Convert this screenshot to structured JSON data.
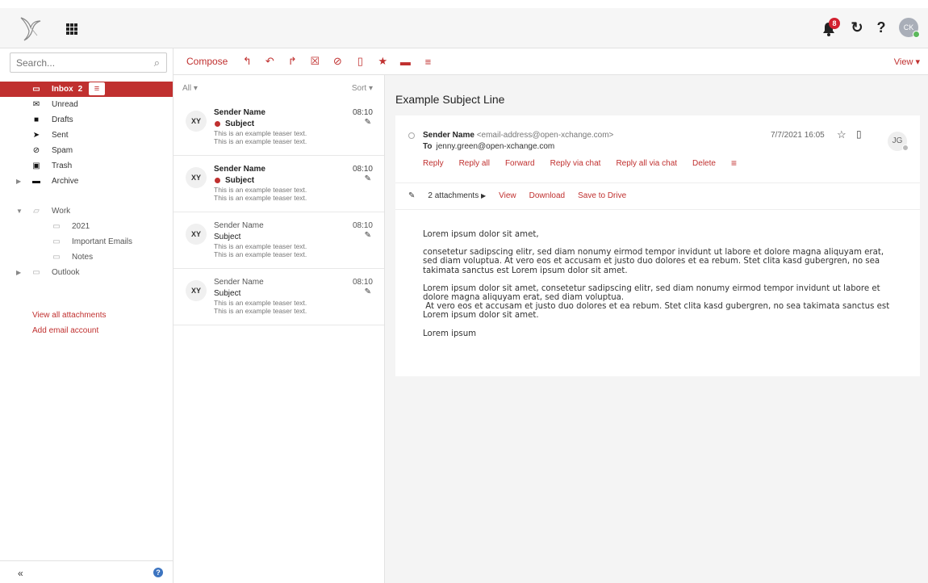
{
  "topbar": {
    "notification_count": "8",
    "avatar_initials": "CK"
  },
  "search": {
    "placeholder": "Search..."
  },
  "folders": [
    {
      "label": "Inbox",
      "count": "2"
    },
    {
      "label": "Unread"
    },
    {
      "label": "Drafts"
    },
    {
      "label": "Sent"
    },
    {
      "label": "Spam"
    },
    {
      "label": "Trash"
    },
    {
      "label": "Archive"
    },
    {
      "label": "Work"
    },
    {
      "label": "2021"
    },
    {
      "label": "Important Emails"
    },
    {
      "label": "Notes"
    },
    {
      "label": "Outlook"
    }
  ],
  "left_links": {
    "attachments": "View all attachments",
    "add_account": "Add email account"
  },
  "toolbar": {
    "compose": "Compose",
    "view": "View"
  },
  "list": {
    "filter": "All",
    "sort": "Sort",
    "items": [
      {
        "initials": "XY",
        "sender": "Sender Name",
        "subject": "Subject",
        "teaser1": "This is an example teaser text.",
        "teaser2": "This is an example teaser text.",
        "time": "08:10"
      },
      {
        "initials": "XY",
        "sender": "Sender Name",
        "subject": "Subject",
        "teaser1": "This is an example teaser text.",
        "teaser2": "This is an example teaser text.",
        "time": "08:10"
      },
      {
        "initials": "XY",
        "sender": "Sender Name",
        "subject": "Subject",
        "teaser1": "This is an example teaser text.",
        "teaser2": "This is an example teaser text.",
        "time": "08:10"
      },
      {
        "initials": "XY",
        "sender": "Sender Name",
        "subject": "Subject",
        "teaser1": "This is an example teaser text.",
        "teaser2": "This is an example teaser text.",
        "time": "08:10"
      }
    ]
  },
  "reader": {
    "subject": "Example Subject Line",
    "sender_name": "Sender Name",
    "sender_address": "<email-address@open-xchange.com>",
    "to_label": "To",
    "to_address": "jenny.green@open-xchange.com",
    "date": "7/7/2021 16:05",
    "avatar_initials": "JG",
    "actions": {
      "reply": "Reply",
      "reply_all": "Reply all",
      "forward": "Forward",
      "reply_chat": "Reply via chat",
      "reply_all_chat": "Reply all via chat",
      "delete": "Delete"
    },
    "attachments": {
      "count": "2 attachments",
      "view": "View",
      "download": "Download",
      "save": "Save to Drive"
    },
    "body": {
      "p1": "Lorem ipsum dolor sit amet,",
      "p2": "consetetur sadipscing elitr, sed diam nonumy eirmod tempor invidunt ut labore et dolore magna aliquyam erat, sed diam voluptua. At vero eos et accusam et justo duo dolores et ea rebum. Stet clita kasd gubergren, no sea takimata sanctus est Lorem ipsum dolor sit amet.",
      "p3a": "Lorem ipsum dolor sit amet, consetetur sadipscing elitr, sed diam nonumy eirmod tempor invidunt ut labore et dolore magna aliquyam erat, sed diam voluptua.",
      "p3b": "At vero eos et accusam et justo duo dolores et ea rebum. Stet clita kasd gubergren, no sea takimata sanctus est Lorem ipsum dolor sit amet.",
      "p4": "Lorem ipsum"
    }
  },
  "colors": {
    "accent": "#c0302f",
    "badge": "#d2202f"
  }
}
